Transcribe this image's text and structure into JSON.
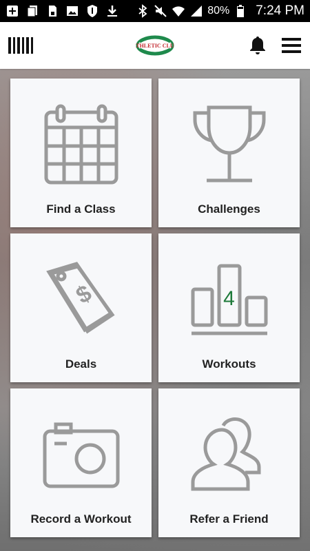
{
  "status_bar": {
    "battery": "80%",
    "time": "7:24 PM"
  },
  "header": {
    "logo_text": "ATHLETIC CLUB"
  },
  "tiles": [
    {
      "label": "Find a Class",
      "icon": "calendar-icon"
    },
    {
      "label": "Challenges",
      "icon": "trophy-icon"
    },
    {
      "label": "Deals",
      "icon": "price-tag-icon"
    },
    {
      "label": "Workouts",
      "icon": "leaderboard-icon",
      "badge": "4"
    },
    {
      "label": "Record a Workout",
      "icon": "camera-icon"
    },
    {
      "label": "Refer a Friend",
      "icon": "users-icon"
    }
  ],
  "colors": {
    "icon_gray": "#9a9a9a",
    "badge_green": "#1e7a3a",
    "logo_green": "#1f8a4c",
    "logo_red": "#c1272d"
  }
}
